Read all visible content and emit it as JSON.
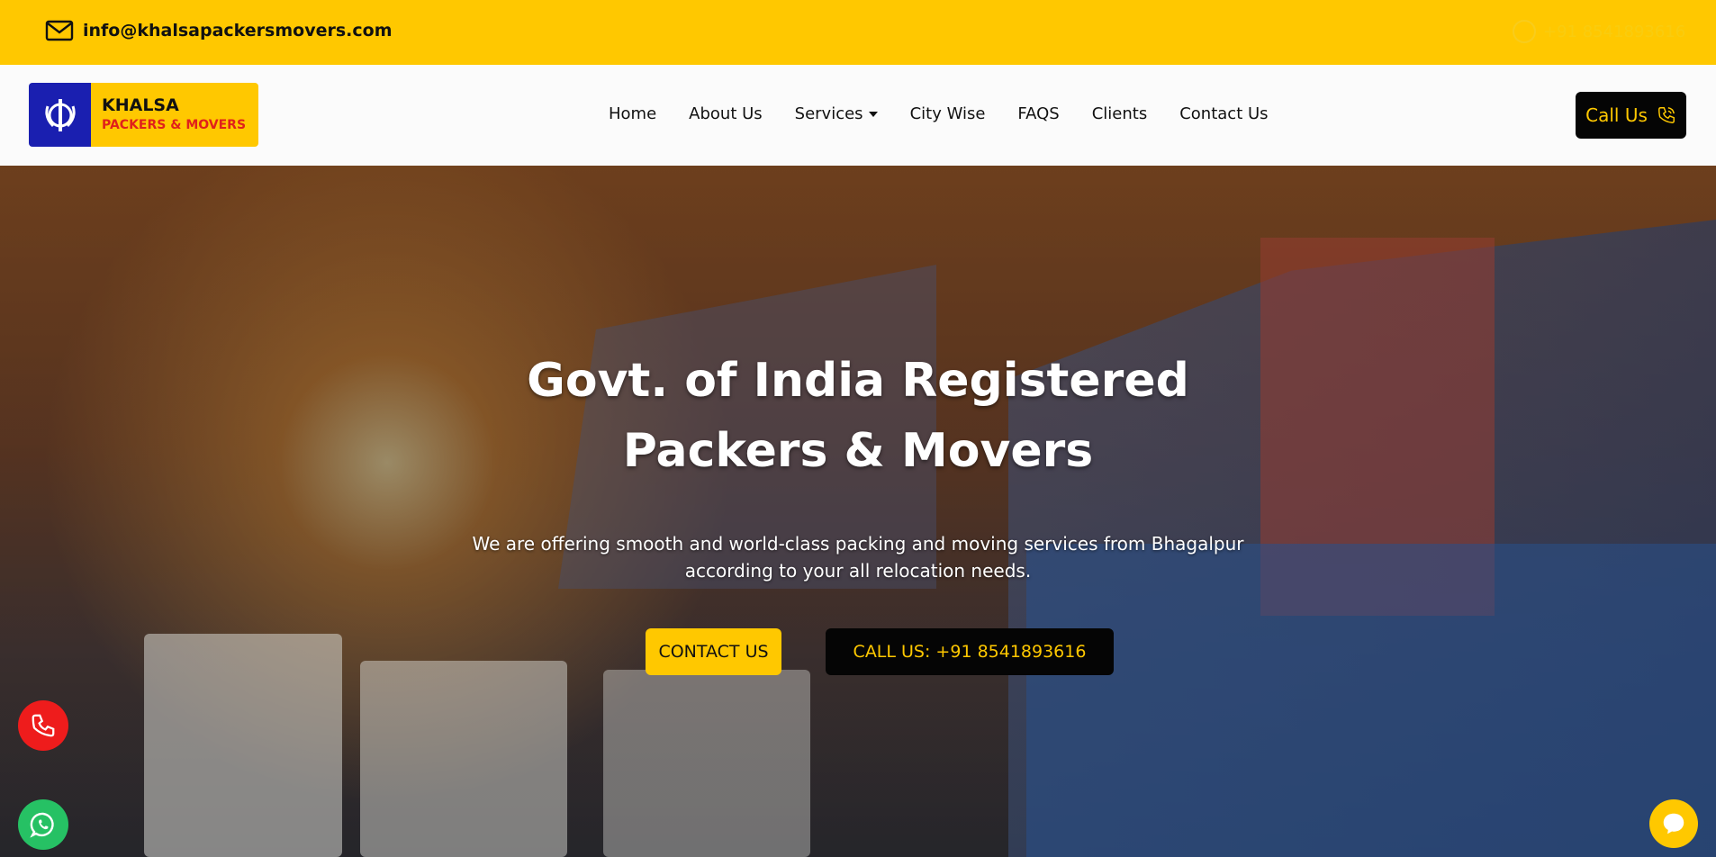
{
  "topbar": {
    "email": "info@khalsapackersmovers.com",
    "phone": "+91 8541893616"
  },
  "logo": {
    "line1": "KHALSA",
    "line2": "PACKERS & MOVERS"
  },
  "nav": {
    "items": [
      {
        "label": "Home"
      },
      {
        "label": "About Us"
      },
      {
        "label": "Services",
        "dropdown": true
      },
      {
        "label": "City Wise"
      },
      {
        "label": "FAQS"
      },
      {
        "label": "Clients"
      },
      {
        "label": "Contact Us"
      }
    ],
    "call_label": "Call Us"
  },
  "hero": {
    "title_line1": "Govt. of India Registered",
    "title_line2": "Packers & Movers",
    "subtitle_line1": "We are offering smooth and world-class packing and moving services from Bhagalpur",
    "subtitle_line2": "according to your all relocation needs.",
    "contact_button": "CONTACT US",
    "call_button": "CALL US: +91 8541893616"
  },
  "colors": {
    "brand_yellow": "#ffc800",
    "brand_blue": "#1a1fb0",
    "brand_red": "#e0211b",
    "dark": "#050505",
    "whatsapp_green": "#26c164"
  }
}
